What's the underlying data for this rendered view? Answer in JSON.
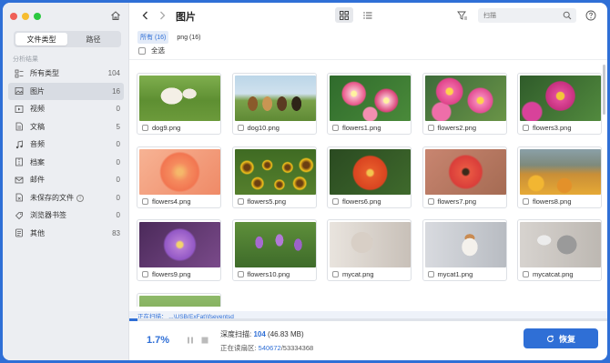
{
  "colors": {
    "accent": "#2f6fd6",
    "traffic_red": "#ef5f57",
    "traffic_yellow": "#f6bc2f",
    "traffic_green": "#2bc840"
  },
  "sidebar": {
    "tabs": [
      {
        "label": "文件类型",
        "active": true
      },
      {
        "label": "路径",
        "active": false
      }
    ],
    "section_title": "分析结果",
    "items": [
      {
        "label": "所有类型",
        "count": "104",
        "icon": "list-icon"
      },
      {
        "label": "图片",
        "count": "16",
        "icon": "image-icon",
        "selected": true
      },
      {
        "label": "视频",
        "count": "0",
        "icon": "video-icon"
      },
      {
        "label": "文稿",
        "count": "5",
        "icon": "document-icon"
      },
      {
        "label": "音频",
        "count": "0",
        "icon": "music-icon"
      },
      {
        "label": "档案",
        "count": "0",
        "icon": "archive-icon"
      },
      {
        "label": "邮件",
        "count": "0",
        "icon": "mail-icon"
      },
      {
        "label": "未保存的文件",
        "count": "0",
        "icon": "unsaved-icon"
      },
      {
        "label": "浏览器书签",
        "count": "0",
        "icon": "bookmark-icon"
      },
      {
        "label": "其他",
        "count": "83",
        "icon": "other-icon"
      }
    ]
  },
  "toolbar": {
    "title": "图片",
    "search_placeholder": "扫描"
  },
  "filters": {
    "chips": [
      {
        "label": "所有 (16)",
        "active": true
      },
      {
        "label": "png (16)",
        "active": false
      }
    ],
    "select_all": "全选"
  },
  "files": [
    {
      "name": "dog9.png",
      "thumb": "dog9"
    },
    {
      "name": "dog10.png",
      "thumb": "dog10"
    },
    {
      "name": "flowers1.png",
      "thumb": "flowers1"
    },
    {
      "name": "flowers2.png",
      "thumb": "flowers2"
    },
    {
      "name": "flowers3.png",
      "thumb": "flowers3"
    },
    {
      "name": "flowers4.png",
      "thumb": "flowers4"
    },
    {
      "name": "flowers5.png",
      "thumb": "flowers5"
    },
    {
      "name": "flowers6.png",
      "thumb": "flowers6"
    },
    {
      "name": "flowers7.png",
      "thumb": "flowers7"
    },
    {
      "name": "flowers8.png",
      "thumb": "flowers8"
    },
    {
      "name": "flowers9.png",
      "thumb": "flowers9"
    },
    {
      "name": "flowers10.png",
      "thumb": "flowers10"
    },
    {
      "name": "mycat.png",
      "thumb": "mycat"
    },
    {
      "name": "mycat1.png",
      "thumb": "mycat1"
    },
    {
      "name": "mycatcat.png",
      "thumb": "mycatcat"
    },
    {
      "name": "",
      "thumb": "dog-partial"
    }
  ],
  "status": {
    "scanning_text": "正在扫描： ...\\USB(ExFat)\\fseventsd",
    "progress_pct": "1.7%",
    "progress_fraction": 0.017,
    "deep_scan_label": "深度扫描: ",
    "deep_scan_count": "104",
    "deep_scan_size": " (46.83 MB)",
    "reading_label": "正在读扇区: ",
    "reading_current": "540672",
    "reading_total": "/53334368"
  },
  "recover_button": "恢复"
}
